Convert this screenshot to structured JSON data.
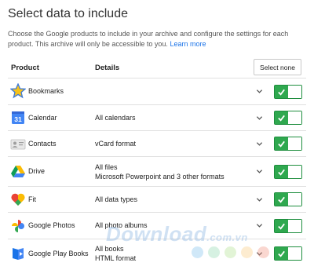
{
  "page": {
    "title": "Select data to include",
    "description": "Choose the Google products to include in your archive and configure the settings for each product. This archive will only be accessible to you.",
    "learn_more": "Learn more"
  },
  "table": {
    "col_product": "Product",
    "col_details": "Details",
    "select_none": "Select none",
    "rows": [
      {
        "product": "Bookmarks",
        "details": [
          "",
          ""
        ],
        "icon": "bookmarks-star-icon",
        "enabled": true
      },
      {
        "product": "Calendar",
        "details": [
          "All calendars",
          ""
        ],
        "icon": "calendar-icon",
        "enabled": true
      },
      {
        "product": "Contacts",
        "details": [
          "vCard format",
          ""
        ],
        "icon": "contacts-card-icon",
        "enabled": true
      },
      {
        "product": "Drive",
        "details": [
          "All files",
          "Microsoft Powerpoint and 3 other formats"
        ],
        "icon": "drive-icon",
        "enabled": true
      },
      {
        "product": "Fit",
        "details": [
          "All data types",
          ""
        ],
        "icon": "fit-heart-icon",
        "enabled": true
      },
      {
        "product": "Google Photos",
        "details": [
          "All photo albums",
          ""
        ],
        "icon": "photos-pinwheel-icon",
        "enabled": true
      },
      {
        "product": "Google Play Books",
        "details": [
          "All books",
          "HTML format"
        ],
        "icon": "play-books-icon",
        "enabled": true
      }
    ]
  },
  "watermark": {
    "text": "Download",
    "suffix": ".com.vn"
  },
  "colors": {
    "toggle_on": "#2fa84f",
    "link": "#1a73e8",
    "divider": "#e0e0e0"
  }
}
